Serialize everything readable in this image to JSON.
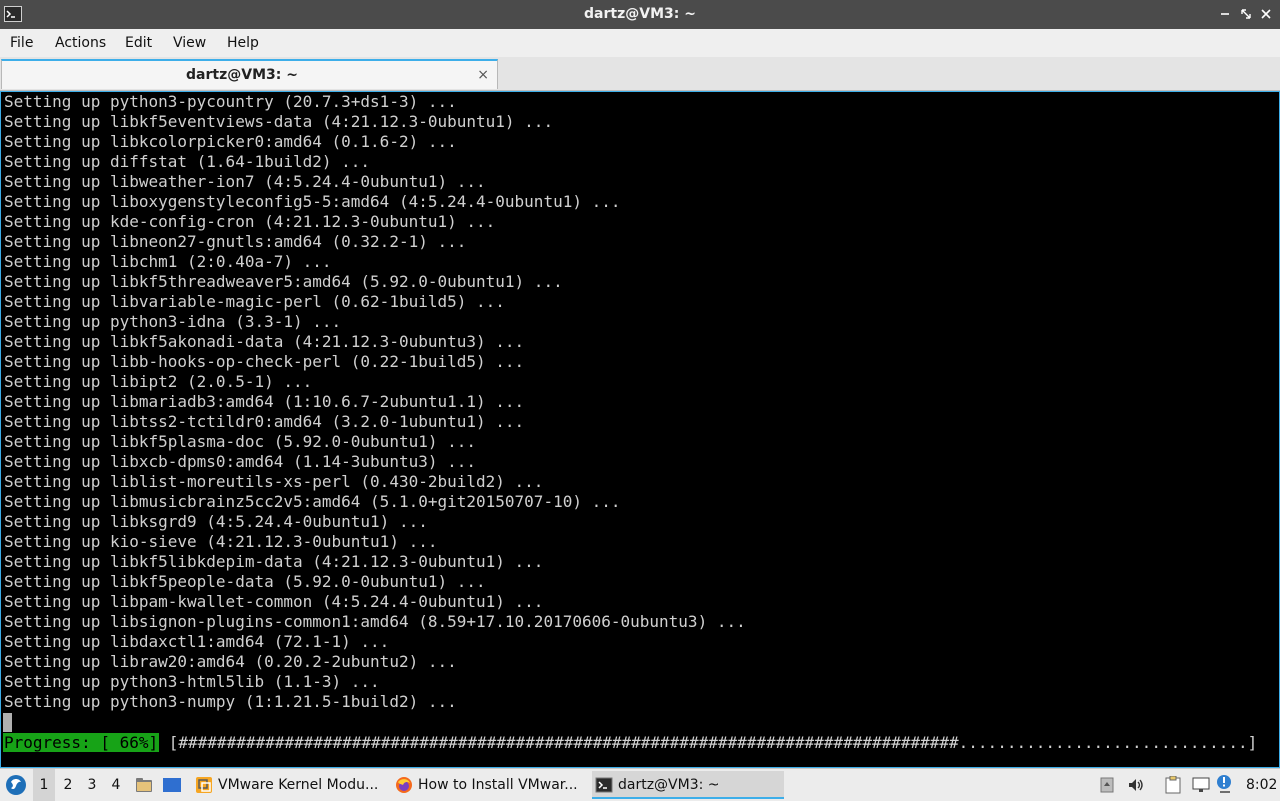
{
  "window": {
    "title": "dartz@VM3: ~",
    "icon": "terminal-icon"
  },
  "menu": [
    "File",
    "Actions",
    "Edit",
    "View",
    "Help"
  ],
  "tab": {
    "label": "dartz@VM3: ~",
    "close": "×"
  },
  "terminal": {
    "lines": [
      "Setting up python3-pycountry (20.7.3+ds1-3) ...",
      "Setting up libkf5eventviews-data (4:21.12.3-0ubuntu1) ...",
      "Setting up libkcolorpicker0:amd64 (0.1.6-2) ...",
      "Setting up diffstat (1.64-1build2) ...",
      "Setting up libweather-ion7 (4:5.24.4-0ubuntu1) ...",
      "Setting up liboxygenstyleconfig5-5:amd64 (4:5.24.4-0ubuntu1) ...",
      "Setting up kde-config-cron (4:21.12.3-0ubuntu1) ...",
      "Setting up libneon27-gnutls:amd64 (0.32.2-1) ...",
      "Setting up libchm1 (2:0.40a-7) ...",
      "Setting up libkf5threadweaver5:amd64 (5.92.0-0ubuntu1) ...",
      "Setting up libvariable-magic-perl (0.62-1build5) ...",
      "Setting up python3-idna (3.3-1) ...",
      "Setting up libkf5akonadi-data (4:21.12.3-0ubuntu3) ...",
      "Setting up libb-hooks-op-check-perl (0.22-1build5) ...",
      "Setting up libipt2 (2.0.5-1) ...",
      "Setting up libmariadb3:amd64 (1:10.6.7-2ubuntu1.1) ...",
      "Setting up libtss2-tctildr0:amd64 (3.2.0-1ubuntu1) ...",
      "Setting up libkf5plasma-doc (5.92.0-0ubuntu1) ...",
      "Setting up libxcb-dpms0:amd64 (1.14-3ubuntu3) ...",
      "Setting up liblist-moreutils-xs-perl (0.430-2build2) ...",
      "Setting up libmusicbrainz5cc2v5:amd64 (5.1.0+git20150707-10) ...",
      "Setting up libksgrd9 (4:5.24.4-0ubuntu1) ...",
      "Setting up kio-sieve (4:21.12.3-0ubuntu1) ...",
      "Setting up libkf5libkdepim-data (4:21.12.3-0ubuntu1) ...",
      "Setting up libkf5people-data (5.92.0-0ubuntu1) ...",
      "Setting up libpam-kwallet-common (4:5.24.4-0ubuntu1) ...",
      "Setting up libsignon-plugins-common1:amd64 (8.59+17.10.20170606-0ubuntu3) ...",
      "Setting up libdaxctl1:amd64 (72.1-1) ...",
      "Setting up libraw20:amd64 (0.20.2-2ubuntu2) ...",
      "Setting up python3-html5lib (1.1-3) ...",
      "Setting up python3-numpy (1:1.21.5-1build2) ..."
    ],
    "progress": {
      "label": "Progress: [ 66%]",
      "bar": "[#################################################################################..............................]",
      "percent": 66,
      "label_color": "#17a317"
    }
  },
  "taskbar": {
    "desktops": [
      "1",
      "2",
      "3",
      "4"
    ],
    "tasks": [
      {
        "label": "VMware Kernel Modu...",
        "icon": "vmware-icon"
      },
      {
        "label": "How to Install VMwar...",
        "icon": "firefox-icon"
      },
      {
        "label": "dartz@VM3: ~",
        "icon": "terminal-icon"
      }
    ],
    "clock": "8:02",
    "tray_icons": [
      "usb-icon",
      "volume-icon",
      "clipboard-icon",
      "network-icon",
      "notification-icon"
    ]
  },
  "colors": {
    "accent": "#3daee9",
    "titlebar": "#4b4b4b",
    "terminal_bg": "#000000",
    "terminal_fg": "#d0d0d0"
  }
}
